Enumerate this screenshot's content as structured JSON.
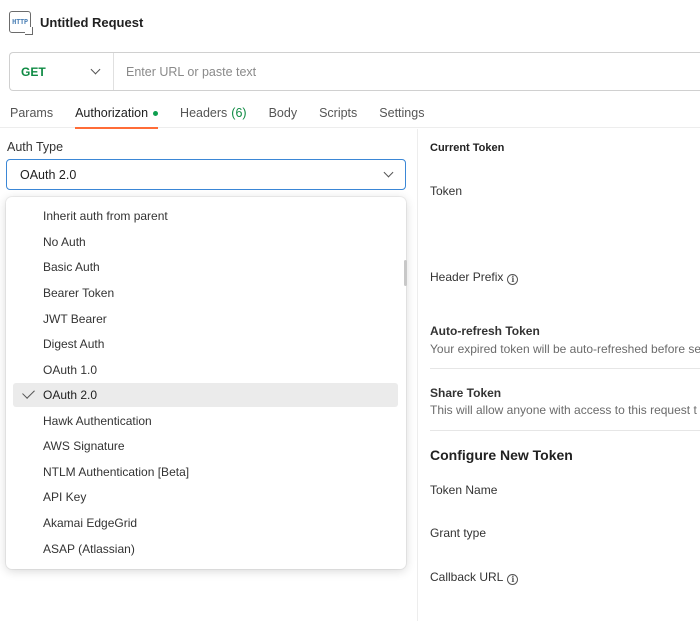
{
  "header": {
    "icon_text": "HTTP",
    "title": "Untitled Request"
  },
  "url_bar": {
    "method": "GET",
    "placeholder": "Enter URL or paste text"
  },
  "tabs": [
    {
      "label": "Params"
    },
    {
      "label": "Authorization"
    },
    {
      "label": "Headers",
      "count": "(6)"
    },
    {
      "label": "Body"
    },
    {
      "label": "Scripts"
    },
    {
      "label": "Settings"
    }
  ],
  "auth": {
    "type_label": "Auth Type",
    "selected": "OAuth 2.0",
    "options": [
      "Inherit auth from parent",
      "No Auth",
      "Basic Auth",
      "Bearer Token",
      "JWT Bearer",
      "Digest Auth",
      "OAuth 1.0",
      "OAuth 2.0",
      "Hawk Authentication",
      "AWS Signature",
      "NTLM Authentication [Beta]",
      "API Key",
      "Akamai EdgeGrid",
      "ASAP (Atlassian)"
    ]
  },
  "right_panel": {
    "current_token": "Current Token",
    "token": "Token",
    "header_prefix": "Header Prefix",
    "auto_refresh_title": "Auto-refresh Token",
    "auto_refresh_desc": "Your expired token will be auto-refreshed before se",
    "share_token_title": "Share Token",
    "share_token_desc": "This will allow anyone with access to this request t",
    "configure_heading": "Configure New Token",
    "token_name": "Token Name",
    "grant_type": "Grant type",
    "callback_url": "Callback URL"
  },
  "colors": {
    "accent": "#ff6c37",
    "method_get": "#0e8a43",
    "focus_border": "#3b87d6",
    "status_dot": "#0e9f4f"
  }
}
